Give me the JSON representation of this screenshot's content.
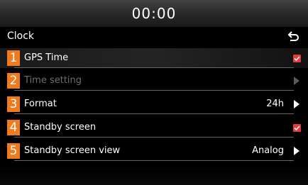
{
  "status_bar": {
    "time": "00:00"
  },
  "header": {
    "title": "Clock",
    "back_icon": "return-arrow-icon"
  },
  "colors": {
    "number_badge": "#f07a1e",
    "checkbox_checked": "#e63b3b",
    "disabled_text": "#6e6e6e"
  },
  "items": [
    {
      "number": "1",
      "label": "GPS Time",
      "control": "checkbox",
      "checked": true,
      "enabled": true
    },
    {
      "number": "2",
      "label": "Time setting",
      "control": "arrow",
      "enabled": false
    },
    {
      "number": "3",
      "label": "Format",
      "value": "24h",
      "control": "arrow",
      "enabled": true
    },
    {
      "number": "4",
      "label": "Standby screen",
      "control": "checkbox",
      "checked": true,
      "enabled": true
    },
    {
      "number": "5",
      "label": "Standby screen view",
      "value": "Analog",
      "control": "arrow",
      "enabled": true
    }
  ]
}
